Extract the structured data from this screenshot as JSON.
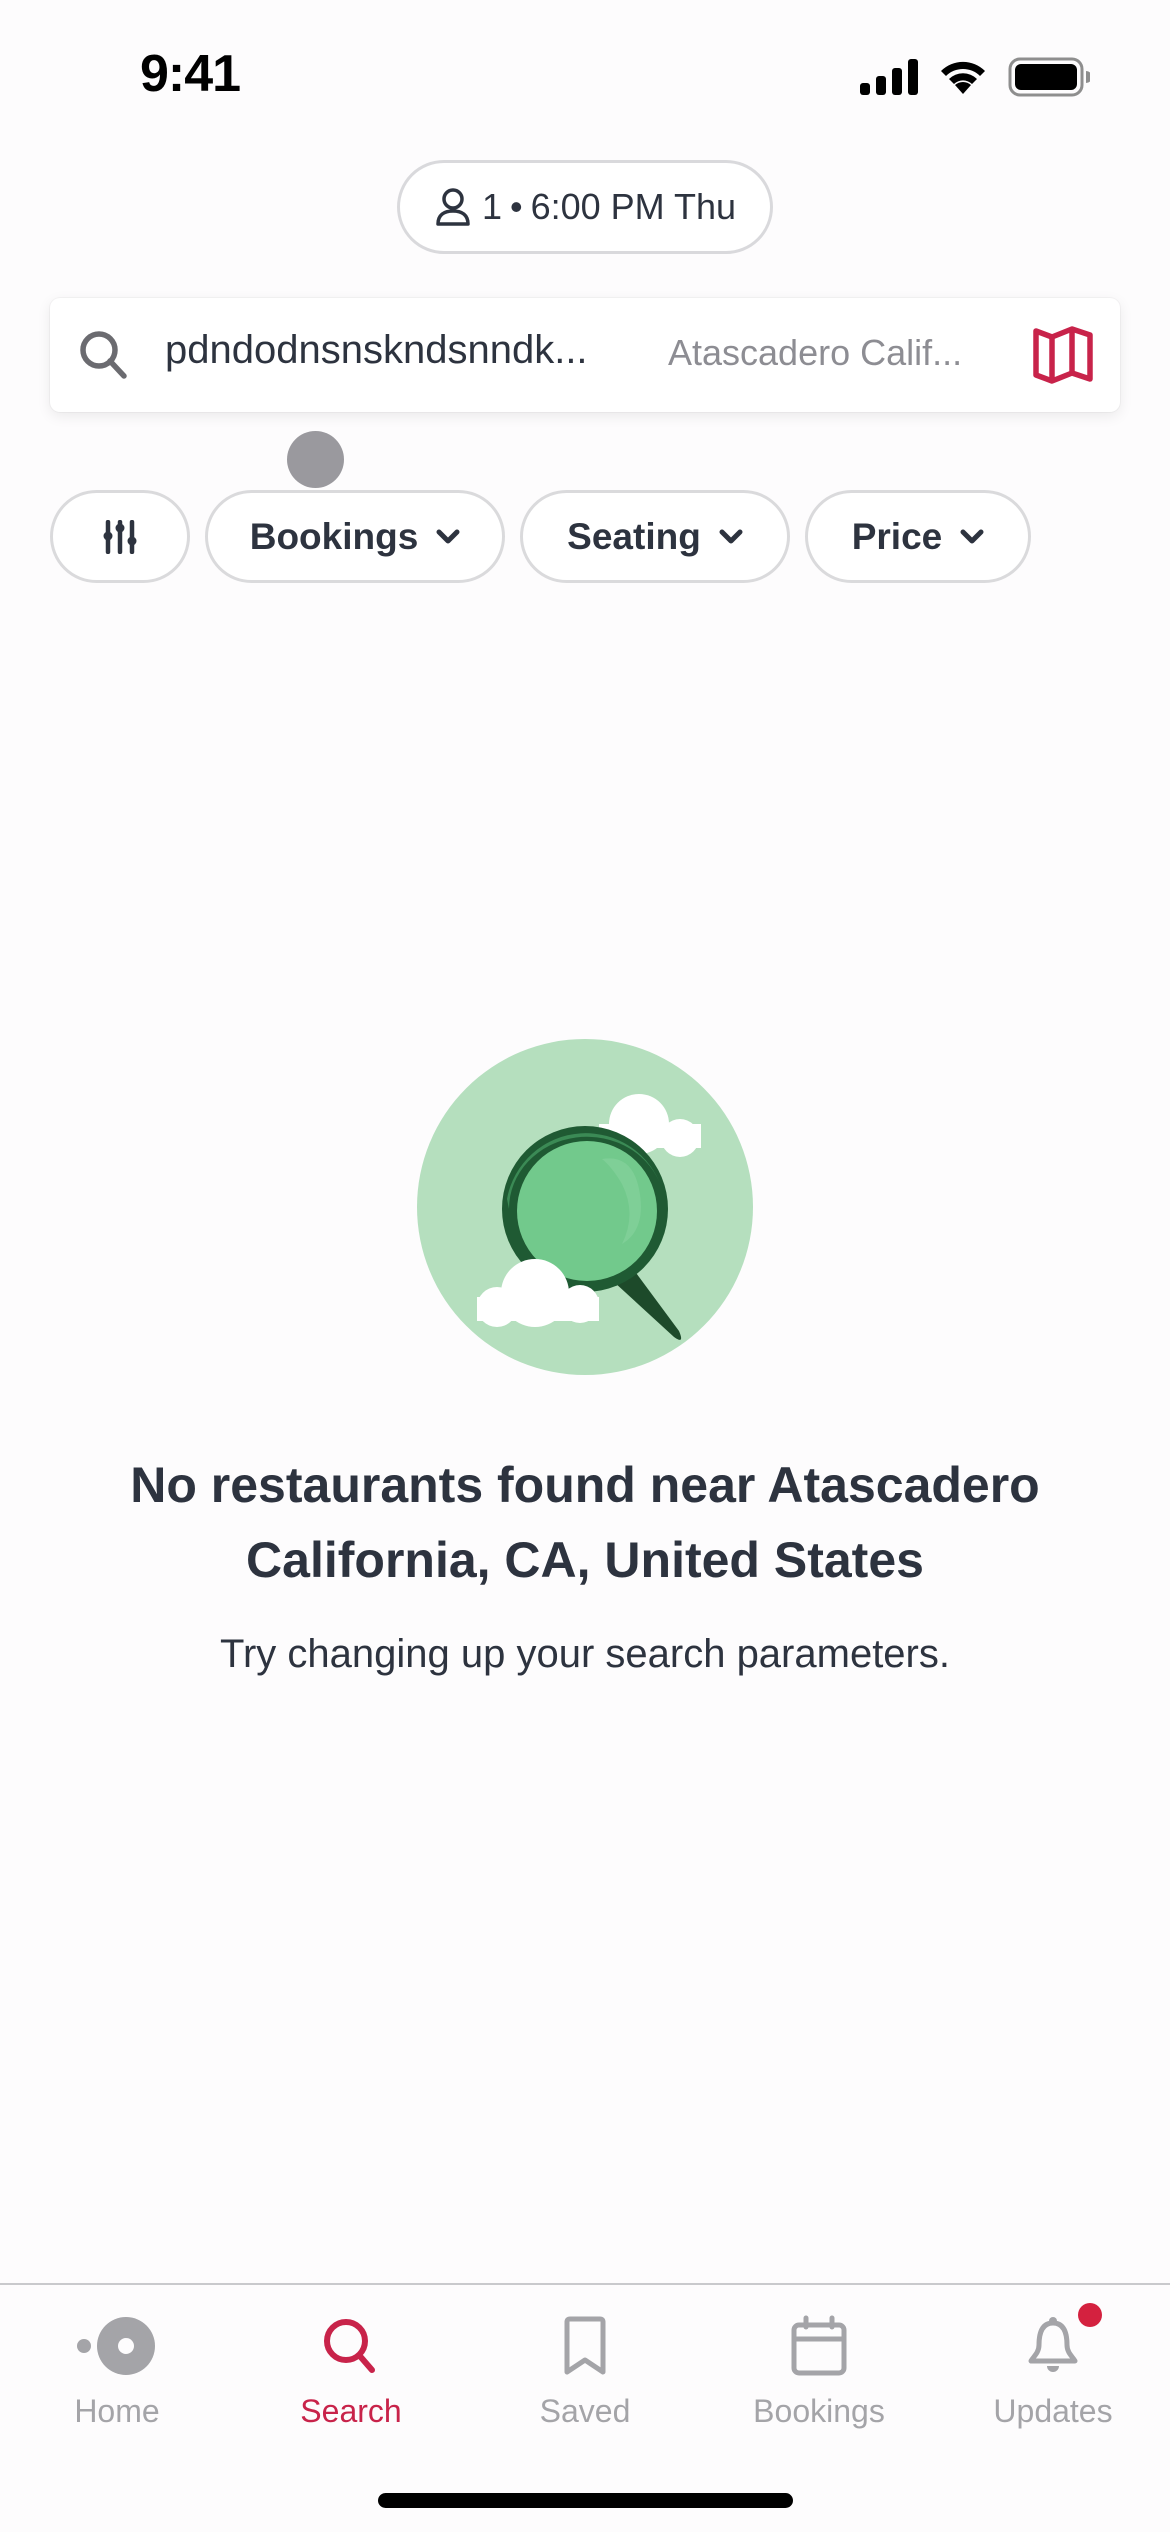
{
  "status_bar": {
    "time": "9:41",
    "icons": [
      "cellular-signal-icon",
      "wifi-icon",
      "battery-icon"
    ]
  },
  "party_selector": {
    "icon": "person-icon",
    "party_size": "1",
    "separator": "•",
    "time_day": "6:00 PM Thu"
  },
  "search": {
    "icon": "search-icon",
    "query": "pdndodnsnskndsnndk...",
    "location": "Atascadero Calif...",
    "map_button_icon": "map-icon"
  },
  "filters": [
    {
      "type": "icon",
      "icon": "sliders-icon",
      "label": ""
    },
    {
      "type": "dropdown",
      "label": "Bookings",
      "icon": "chevron-down-icon"
    },
    {
      "type": "dropdown",
      "label": "Seating",
      "icon": "chevron-down-icon"
    },
    {
      "type": "dropdown",
      "label": "Price",
      "icon": "chevron-down-icon"
    }
  ],
  "empty_state": {
    "illustration": "magnifying-glass-clouds-illustration",
    "title_line1": "No restaurants found near Atascadero",
    "title_line2": "California, CA, United States",
    "subtitle": "Try changing up your search parameters."
  },
  "tab_bar": {
    "active": "Search",
    "items": [
      {
        "label": "Home",
        "icon": "home-icon"
      },
      {
        "label": "Search",
        "icon": "search-icon"
      },
      {
        "label": "Saved",
        "icon": "bookmark-icon"
      },
      {
        "label": "Bookings",
        "icon": "calendar-icon"
      },
      {
        "label": "Updates",
        "icon": "bell-icon",
        "has_notification": true
      }
    ]
  },
  "colors": {
    "accent": "#c8234a",
    "text_primary": "#2d333f",
    "text_muted": "#8d8d93",
    "tab_inactive": "#a4a4a8",
    "notification": "#d4213f",
    "illustration_bg": "#b5dfbe",
    "illustration_lens": "#72c98c",
    "illustration_frame": "#1f5a33"
  }
}
